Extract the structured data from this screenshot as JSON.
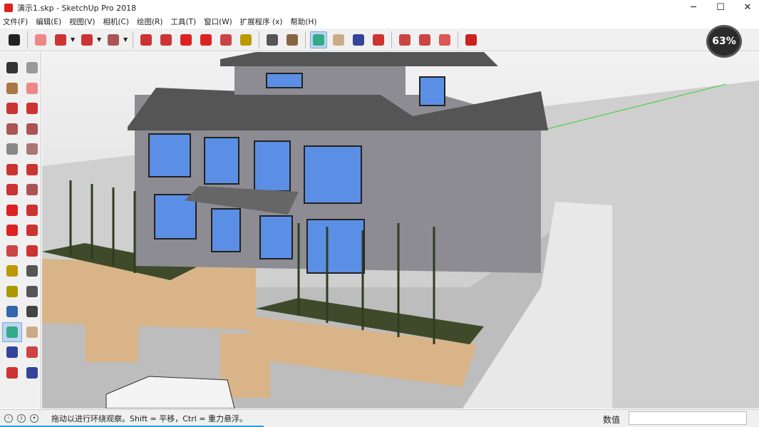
{
  "window": {
    "title": "演示1.skp - SketchUp Pro 2018",
    "minimize": "─",
    "maximize": "☐",
    "close": "✕"
  },
  "menu": [
    "文件(F)",
    "编辑(E)",
    "视图(V)",
    "相机(C)",
    "绘图(R)",
    "工具(T)",
    "窗口(W)",
    "扩展程序 (x)",
    "帮助(H)"
  ],
  "toolbar": [
    {
      "icon": "select-icon",
      "color": "#222"
    },
    {
      "icon": "eraser-icon",
      "color": "#e88"
    },
    {
      "icon": "pencil-icon",
      "color": "#c33",
      "dropdown": true
    },
    {
      "icon": "arc-icon",
      "color": "#c33",
      "dropdown": true
    },
    {
      "icon": "rectangle-icon",
      "color": "#a55",
      "dropdown": true
    },
    {
      "icon": "push-pull-icon",
      "color": "#c33"
    },
    {
      "icon": "follow-me-icon",
      "color": "#c33"
    },
    {
      "icon": "move-icon",
      "color": "#d22"
    },
    {
      "icon": "rotate-icon",
      "color": "#d22"
    },
    {
      "icon": "scale-icon",
      "color": "#c44"
    },
    {
      "icon": "tape-measure-icon",
      "color": "#b90"
    },
    {
      "icon": "text-icon",
      "color": "#555"
    },
    {
      "icon": "paint-bucket-icon",
      "color": "#864"
    },
    {
      "icon": "orbit-icon",
      "color": "#3a8",
      "active": true
    },
    {
      "icon": "pan-icon",
      "color": "#ca8"
    },
    {
      "icon": "zoom-icon",
      "color": "#349"
    },
    {
      "icon": "zoom-extents-icon",
      "color": "#c33"
    },
    {
      "icon": "warehouse-icon",
      "color": "#c44"
    },
    {
      "icon": "share-model-icon",
      "color": "#c44"
    },
    {
      "icon": "extension-warehouse-icon",
      "color": "#d55"
    },
    {
      "icon": "ruby-icon",
      "color": "#c22"
    }
  ],
  "left_tools": [
    "select-icon",
    "component-icon",
    "paint-bucket-icon",
    "eraser-icon",
    "line-icon",
    "freehand-icon",
    "rectangle-icon",
    "rotated-rectangle-icon",
    "circle-icon",
    "polygon-icon",
    "arc-icon",
    "pie-icon",
    "arc-3pt-icon",
    "pie-2-icon",
    "move-icon",
    "push-pull-icon",
    "rotate-icon",
    "follow-me-icon",
    "scale-icon",
    "offset-icon",
    "tape-measure-icon",
    "dimension-icon",
    "protractor-icon",
    "text-icon",
    "axes-icon",
    "3d-text-icon",
    "orbit-icon",
    "pan-icon",
    "zoom-icon",
    "zoom-window-icon",
    "zoom-extents-icon",
    "previous-view-icon"
  ],
  "overlay": {
    "percent": "63%"
  },
  "status": {
    "text": "拖动以进行环绕观察。Shift = 平移，Ctrl = 重力悬浮。",
    "measure_label": "数值",
    "measure_value": ""
  },
  "colors": {
    "accent": "#2b9fe0",
    "active_bg": "#bcd6ee"
  }
}
